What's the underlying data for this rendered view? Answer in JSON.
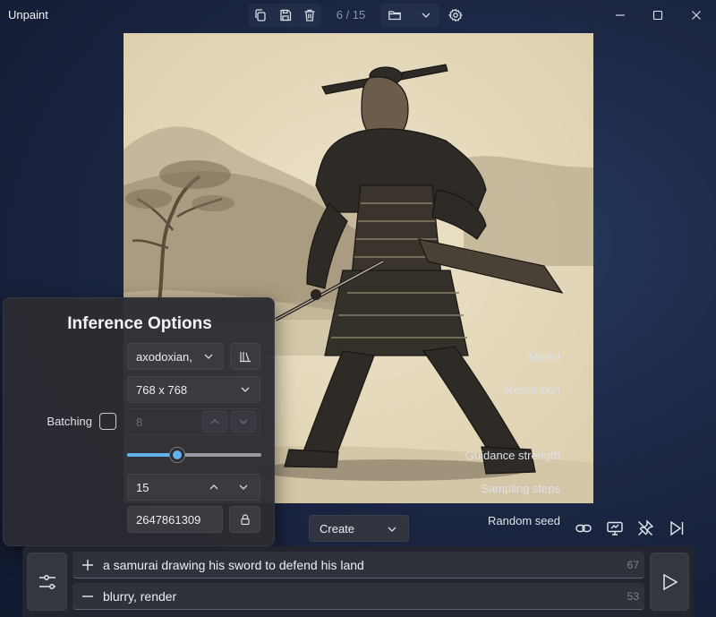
{
  "app": {
    "title": "Unpaint"
  },
  "toolbar": {
    "page_counter": "6 / 15",
    "icons": [
      "copy-icon",
      "save-icon",
      "delete-icon",
      "folder-icon",
      "chevron-down-icon",
      "settings-gear-icon"
    ]
  },
  "window_controls": [
    "minimize",
    "maximize",
    "close"
  ],
  "image": {
    "subject": "sepia ink drawing of a samurai drawing his sword in front of mountains"
  },
  "inference_options": {
    "title": "Inference Options",
    "model": {
      "label": "Model",
      "value": "axodoxian,"
    },
    "resolution": {
      "label": "Resolution",
      "value": "768 x 768"
    },
    "batching": {
      "label": "Batching",
      "checked": false,
      "value": "8"
    },
    "guidance": {
      "label": "Guidance strength",
      "fraction": 0.37
    },
    "sampling_steps": {
      "label": "Sampling steps",
      "value": "15"
    },
    "random_seed": {
      "label": "Random seed",
      "value": "2647861309"
    }
  },
  "mode": {
    "selected": "Create"
  },
  "tools": [
    "link-icon",
    "display-icon",
    "unpin-icon",
    "skip-next-icon"
  ],
  "prompts": {
    "positive": {
      "text": "a samurai drawing his sword to defend his land",
      "count": "67"
    },
    "negative": {
      "text": "blurry, render",
      "count": "53"
    }
  },
  "colors": {
    "accent": "#5fb3ea",
    "panel": "#2c2c32",
    "background": "#1c2744"
  }
}
